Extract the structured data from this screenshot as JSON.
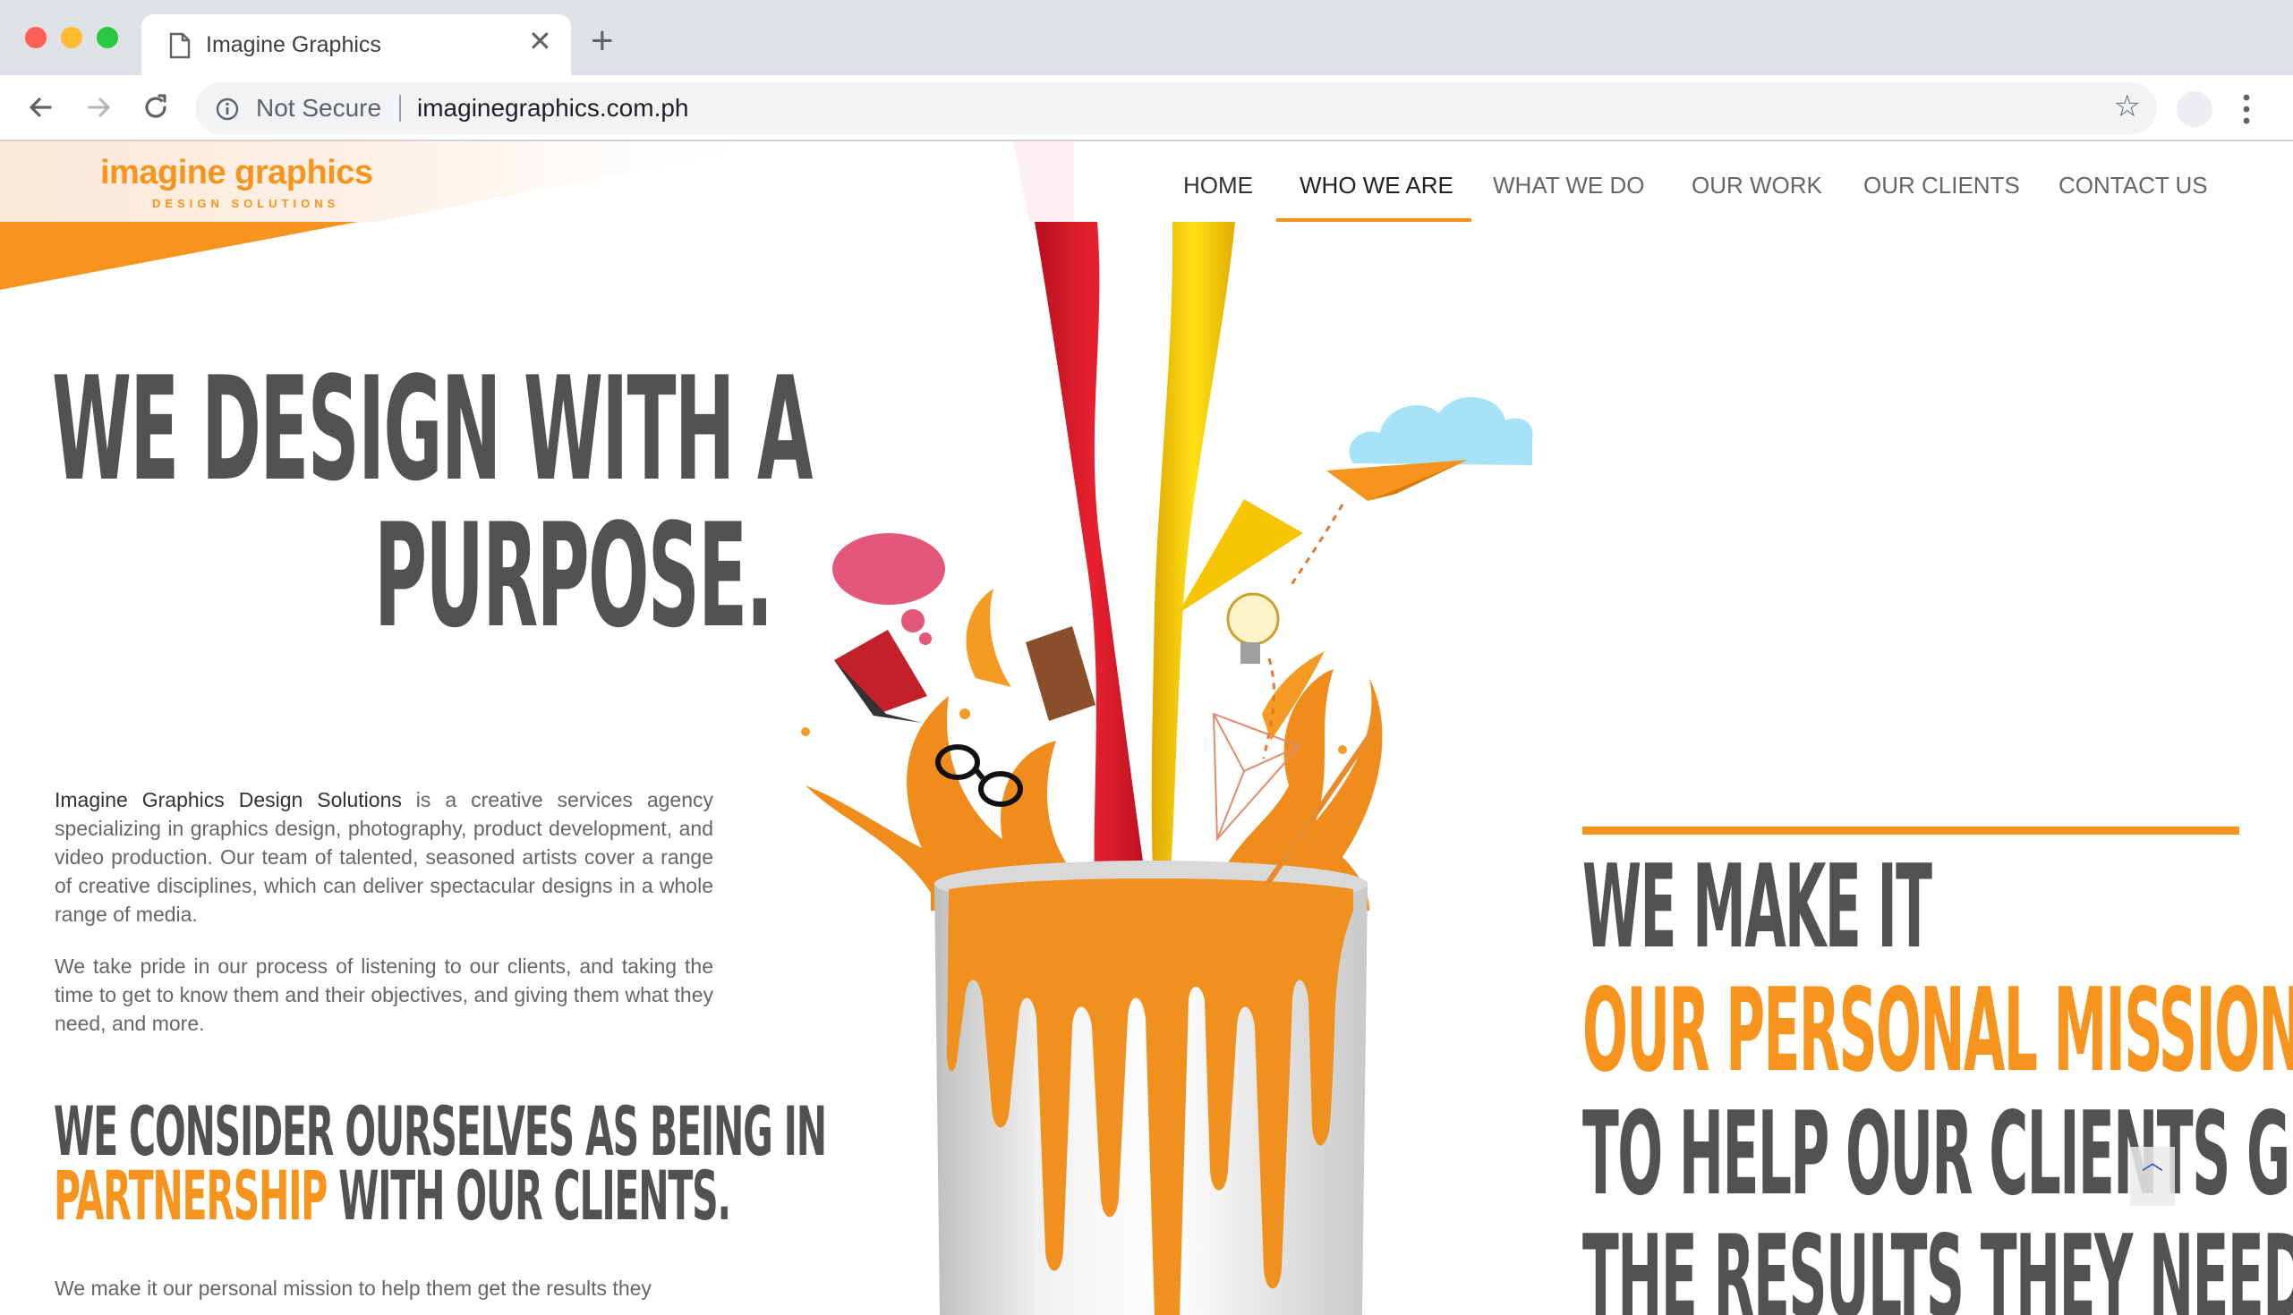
{
  "browser": {
    "tab_title": "Imagine Graphics",
    "security_label": "Not Secure",
    "url": "imaginegraphics.com.ph"
  },
  "site": {
    "logo": {
      "name": "imagine graphics",
      "tagline": "DESIGN SOLUTIONS"
    },
    "nav": [
      {
        "label": "HOME"
      },
      {
        "label": "WHO WE ARE",
        "active": true
      },
      {
        "label": "WHAT WE DO"
      },
      {
        "label": "OUR WORK"
      },
      {
        "label": "OUR CLIENTS"
      },
      {
        "label": "CONTACT US"
      }
    ],
    "hero": {
      "line1": "WE DESIGN WITH A",
      "line2": "PURPOSE."
    },
    "intro": {
      "company": "Imagine Graphics Design Solutions",
      "body": " is a creative services agency specializing in graphics design, photography, product development, and video production. Our team of talented, seasoned artists cover a range of creative disciplines, which can deliver spectacular designs in a whole range of media."
    },
    "paragraph2": "We take pride in our process of listening to our clients, and taking the time to get to know them and their objectives, and giving them what they need, and more.",
    "partnership": {
      "line1": "WE CONSIDER OURSELVES AS BEING IN",
      "highlight": "PARTNERSHIP",
      "line2_rest": " WITH OUR CLIENTS."
    },
    "paragraph3": "We make it our personal mission to help them get the results they",
    "mission": {
      "line1": "WE MAKE IT",
      "line2": "OUR PERSONAL MISSION",
      "line3": "TO HELP OUR CLIENTS GET",
      "line4": "THE RESULTS THEY NEED"
    },
    "scroll_top_icon": "chevron-up-icon"
  },
  "colors": {
    "accent": "#f7941d",
    "heading": "#525252",
    "body_text": "#666666"
  }
}
